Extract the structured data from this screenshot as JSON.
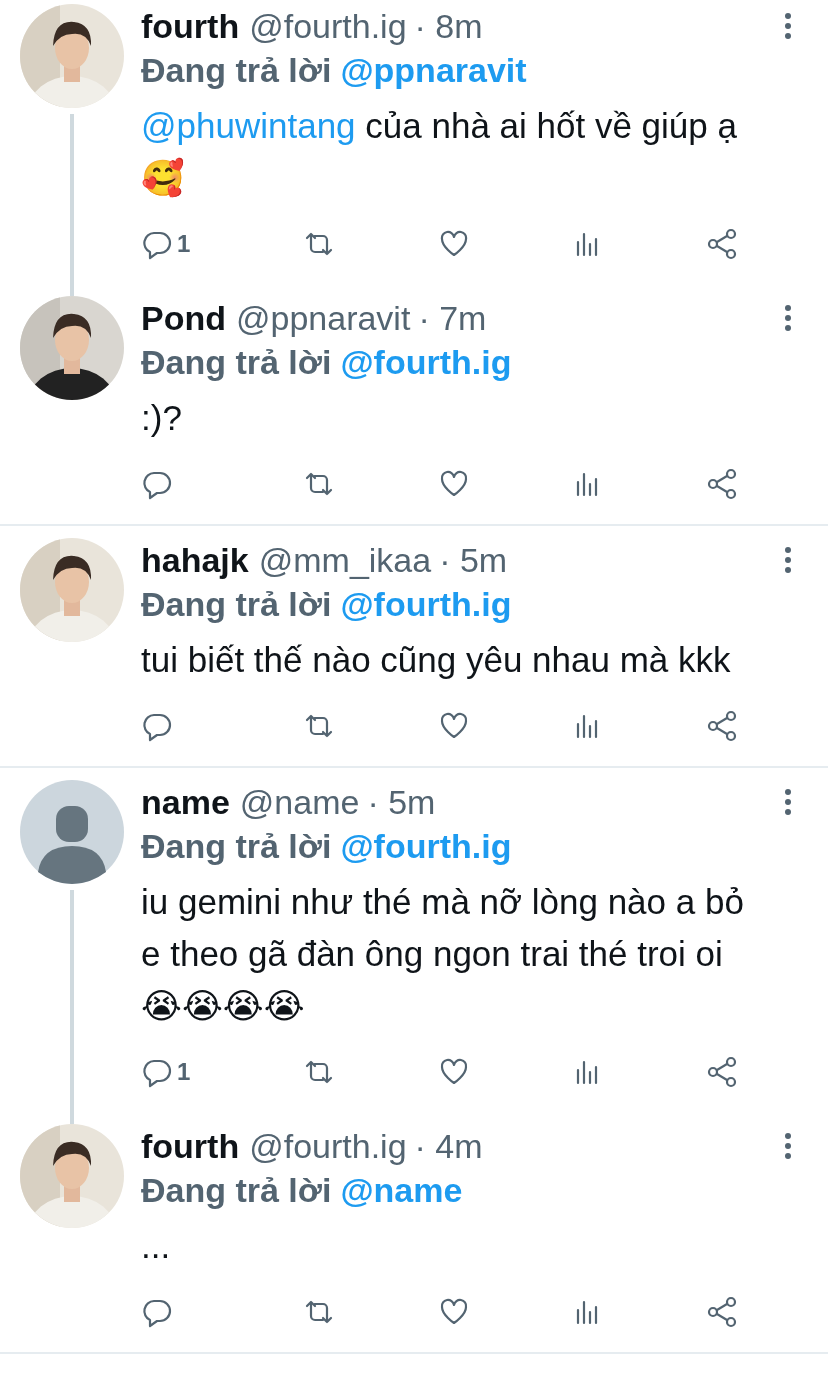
{
  "tweets": [
    {
      "name": "fourth",
      "handle": "@fourth.ig",
      "time": "· 8m",
      "replying_label": "Đang trả lời",
      "replying_to": "@ppnaravit",
      "mention": "@phuwintang",
      "text": "của nhà ai hốt về giúp ạ 🥰",
      "reply_count": "1",
      "thread_continues": true
    },
    {
      "name": "Pond",
      "handle": "@ppnaravit",
      "time": "· 7m",
      "replying_label": "Đang trả lời",
      "replying_to": "@fourth.ig",
      "text": ":)?",
      "thread_continues": false
    },
    {
      "name": "hahajk",
      "handle": "@mm_ikaa",
      "time": "· 5m",
      "replying_label": "Đang trả lời",
      "replying_to": "@fourth.ig",
      "text": "tui biết thế nào cũng yêu nhau mà kkk",
      "thread_continues": false
    },
    {
      "avatar": {
        "kind": "default"
      },
      "name": "name",
      "handle": "@name",
      "time": "· 5m",
      "replying_label": "Đang trả lời",
      "replying_to": "@fourth.ig",
      "text": "iu gemini như thé mà nỡ lòng nào a bỏ e theo gã đàn ông ngon trai thé troi oi 😭😭😭😭",
      "reply_count": "1",
      "thread_continues": true
    },
    {
      "name": "fourth",
      "handle": "@fourth.ig",
      "time": "· 4m",
      "replying_label": "Đang trả lời",
      "replying_to": "@name",
      "text": "...",
      "thread_continues": false
    }
  ]
}
